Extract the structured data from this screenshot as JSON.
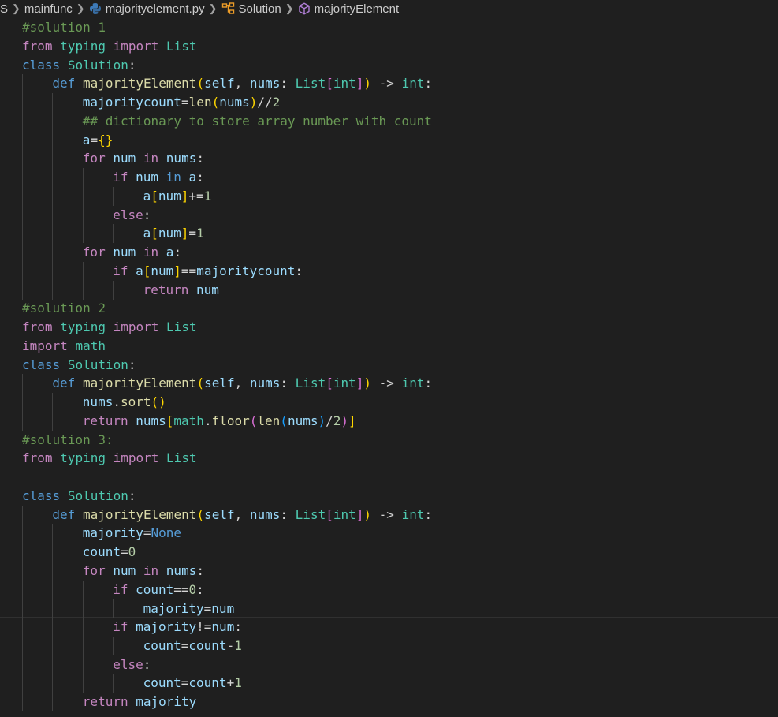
{
  "breadcrumb": {
    "leading": "S",
    "folder": "mainfunc",
    "file": "majorityelement.py",
    "class": "Solution",
    "method": "majorityElement"
  },
  "editor": {
    "current_line_index": 31,
    "colors": {
      "comment": "#6a9955",
      "keyword": "#c586c0",
      "storage": "#569cd6",
      "type": "#4ec9b0",
      "function": "#dcdcaa",
      "variable": "#9cdcfe",
      "number": "#b5cea8",
      "operator": "#d4d4d4",
      "bracket_level1": "#ffd700",
      "bracket_level2": "#da70d6",
      "bracket_level3": "#179fff"
    },
    "lines": [
      {
        "indent": 0,
        "tokens": [
          [
            "c",
            "#solution 1"
          ]
        ]
      },
      {
        "indent": 0,
        "tokens": [
          [
            "k",
            "from"
          ],
          [
            "o",
            " "
          ],
          [
            "t",
            "typing"
          ],
          [
            "o",
            " "
          ],
          [
            "k",
            "import"
          ],
          [
            "o",
            " "
          ],
          [
            "t",
            "List"
          ]
        ]
      },
      {
        "indent": 0,
        "tokens": [
          [
            "s",
            "class"
          ],
          [
            "o",
            " "
          ],
          [
            "t",
            "Solution"
          ],
          [
            "o",
            ":"
          ]
        ]
      },
      {
        "indent": 1,
        "tokens": [
          [
            "s",
            "def"
          ],
          [
            "o",
            " "
          ],
          [
            "f",
            "majorityElement"
          ],
          [
            "b1",
            "("
          ],
          [
            "v",
            "self"
          ],
          [
            "o",
            ", "
          ],
          [
            "v",
            "nums"
          ],
          [
            "o",
            ": "
          ],
          [
            "t",
            "List"
          ],
          [
            "b2",
            "["
          ],
          [
            "t",
            "int"
          ],
          [
            "b2",
            "]"
          ],
          [
            "b1",
            ")"
          ],
          [
            "o",
            " -> "
          ],
          [
            "t",
            "int"
          ],
          [
            "o",
            ":"
          ]
        ]
      },
      {
        "indent": 2,
        "tokens": [
          [
            "v",
            "majoritycount"
          ],
          [
            "o",
            "="
          ],
          [
            "f",
            "len"
          ],
          [
            "b1",
            "("
          ],
          [
            "v",
            "nums"
          ],
          [
            "b1",
            ")"
          ],
          [
            "o",
            "//"
          ],
          [
            "n",
            "2"
          ]
        ]
      },
      {
        "indent": 2,
        "tokens": [
          [
            "c",
            "## dictionary to store array number with count"
          ]
        ]
      },
      {
        "indent": 2,
        "tokens": [
          [
            "v",
            "a"
          ],
          [
            "o",
            "="
          ],
          [
            "b1",
            "{}"
          ]
        ]
      },
      {
        "indent": 2,
        "tokens": [
          [
            "k",
            "for"
          ],
          [
            "o",
            " "
          ],
          [
            "v",
            "num"
          ],
          [
            "o",
            " "
          ],
          [
            "k",
            "in"
          ],
          [
            "o",
            " "
          ],
          [
            "v",
            "nums"
          ],
          [
            "o",
            ":"
          ]
        ]
      },
      {
        "indent": 3,
        "tokens": [
          [
            "k",
            "if"
          ],
          [
            "o",
            " "
          ],
          [
            "v",
            "num"
          ],
          [
            "o",
            " "
          ],
          [
            "s",
            "in"
          ],
          [
            "o",
            " "
          ],
          [
            "v",
            "a"
          ],
          [
            "o",
            ":"
          ]
        ]
      },
      {
        "indent": 4,
        "tokens": [
          [
            "v",
            "a"
          ],
          [
            "b1",
            "["
          ],
          [
            "v",
            "num"
          ],
          [
            "b1",
            "]"
          ],
          [
            "o",
            "+="
          ],
          [
            "n",
            "1"
          ]
        ]
      },
      {
        "indent": 3,
        "tokens": [
          [
            "k",
            "else"
          ],
          [
            "o",
            ":"
          ]
        ]
      },
      {
        "indent": 4,
        "tokens": [
          [
            "v",
            "a"
          ],
          [
            "b1",
            "["
          ],
          [
            "v",
            "num"
          ],
          [
            "b1",
            "]"
          ],
          [
            "o",
            "="
          ],
          [
            "n",
            "1"
          ]
        ]
      },
      {
        "indent": 2,
        "tokens": [
          [
            "k",
            "for"
          ],
          [
            "o",
            " "
          ],
          [
            "v",
            "num"
          ],
          [
            "o",
            " "
          ],
          [
            "k",
            "in"
          ],
          [
            "o",
            " "
          ],
          [
            "v",
            "a"
          ],
          [
            "o",
            ":"
          ]
        ]
      },
      {
        "indent": 3,
        "tokens": [
          [
            "k",
            "if"
          ],
          [
            "o",
            " "
          ],
          [
            "v",
            "a"
          ],
          [
            "b1",
            "["
          ],
          [
            "v",
            "num"
          ],
          [
            "b1",
            "]"
          ],
          [
            "o",
            "=="
          ],
          [
            "v",
            "majoritycount"
          ],
          [
            "o",
            ":"
          ]
        ]
      },
      {
        "indent": 4,
        "tokens": [
          [
            "k",
            "return"
          ],
          [
            "o",
            " "
          ],
          [
            "v",
            "num"
          ]
        ]
      },
      {
        "indent": 0,
        "tokens": [
          [
            "c",
            "#solution 2"
          ]
        ]
      },
      {
        "indent": 0,
        "tokens": [
          [
            "k",
            "from"
          ],
          [
            "o",
            " "
          ],
          [
            "t",
            "typing"
          ],
          [
            "o",
            " "
          ],
          [
            "k",
            "import"
          ],
          [
            "o",
            " "
          ],
          [
            "t",
            "List"
          ]
        ]
      },
      {
        "indent": 0,
        "tokens": [
          [
            "k",
            "import"
          ],
          [
            "o",
            " "
          ],
          [
            "t",
            "math"
          ]
        ]
      },
      {
        "indent": 0,
        "tokens": [
          [
            "s",
            "class"
          ],
          [
            "o",
            " "
          ],
          [
            "t",
            "Solution"
          ],
          [
            "o",
            ":"
          ]
        ]
      },
      {
        "indent": 1,
        "tokens": [
          [
            "s",
            "def"
          ],
          [
            "o",
            " "
          ],
          [
            "f",
            "majorityElement"
          ],
          [
            "b1",
            "("
          ],
          [
            "v",
            "self"
          ],
          [
            "o",
            ", "
          ],
          [
            "v",
            "nums"
          ],
          [
            "o",
            ": "
          ],
          [
            "t",
            "List"
          ],
          [
            "b2",
            "["
          ],
          [
            "t",
            "int"
          ],
          [
            "b2",
            "]"
          ],
          [
            "b1",
            ")"
          ],
          [
            "o",
            " -> "
          ],
          [
            "t",
            "int"
          ],
          [
            "o",
            ":"
          ]
        ]
      },
      {
        "indent": 2,
        "tokens": [
          [
            "v",
            "nums"
          ],
          [
            "o",
            "."
          ],
          [
            "f",
            "sort"
          ],
          [
            "b1",
            "()"
          ]
        ]
      },
      {
        "indent": 2,
        "tokens": [
          [
            "k",
            "return"
          ],
          [
            "o",
            " "
          ],
          [
            "v",
            "nums"
          ],
          [
            "b1",
            "["
          ],
          [
            "t",
            "math"
          ],
          [
            "o",
            "."
          ],
          [
            "f",
            "floor"
          ],
          [
            "b2",
            "("
          ],
          [
            "f",
            "len"
          ],
          [
            "b3",
            "("
          ],
          [
            "v",
            "nums"
          ],
          [
            "b3",
            ")"
          ],
          [
            "o",
            "/"
          ],
          [
            "n",
            "2"
          ],
          [
            "b2",
            ")"
          ],
          [
            "b1",
            "]"
          ]
        ]
      },
      {
        "indent": 0,
        "tokens": [
          [
            "c",
            "#solution 3:"
          ]
        ]
      },
      {
        "indent": 0,
        "tokens": [
          [
            "k",
            "from"
          ],
          [
            "o",
            " "
          ],
          [
            "t",
            "typing"
          ],
          [
            "o",
            " "
          ],
          [
            "k",
            "import"
          ],
          [
            "o",
            " "
          ],
          [
            "t",
            "List"
          ]
        ]
      },
      {
        "indent": 0,
        "tokens": []
      },
      {
        "indent": 0,
        "tokens": [
          [
            "s",
            "class"
          ],
          [
            "o",
            " "
          ],
          [
            "t",
            "Solution"
          ],
          [
            "o",
            ":"
          ]
        ]
      },
      {
        "indent": 1,
        "tokens": [
          [
            "s",
            "def"
          ],
          [
            "o",
            " "
          ],
          [
            "f",
            "majorityElement"
          ],
          [
            "b1",
            "("
          ],
          [
            "v",
            "self"
          ],
          [
            "o",
            ", "
          ],
          [
            "v",
            "nums"
          ],
          [
            "o",
            ": "
          ],
          [
            "t",
            "List"
          ],
          [
            "b2",
            "["
          ],
          [
            "t",
            "int"
          ],
          [
            "b2",
            "]"
          ],
          [
            "b1",
            ")"
          ],
          [
            "o",
            " -> "
          ],
          [
            "t",
            "int"
          ],
          [
            "o",
            ":"
          ]
        ]
      },
      {
        "indent": 2,
        "tokens": [
          [
            "v",
            "majority"
          ],
          [
            "o",
            "="
          ],
          [
            "s",
            "None"
          ]
        ]
      },
      {
        "indent": 2,
        "tokens": [
          [
            "v",
            "count"
          ],
          [
            "o",
            "="
          ],
          [
            "n",
            "0"
          ]
        ]
      },
      {
        "indent": 2,
        "tokens": [
          [
            "k",
            "for"
          ],
          [
            "o",
            " "
          ],
          [
            "v",
            "num"
          ],
          [
            "o",
            " "
          ],
          [
            "k",
            "in"
          ],
          [
            "o",
            " "
          ],
          [
            "v",
            "nums"
          ],
          [
            "o",
            ":"
          ]
        ]
      },
      {
        "indent": 3,
        "tokens": [
          [
            "k",
            "if"
          ],
          [
            "o",
            " "
          ],
          [
            "v",
            "count"
          ],
          [
            "o",
            "=="
          ],
          [
            "n",
            "0"
          ],
          [
            "o",
            ":"
          ]
        ]
      },
      {
        "indent": 4,
        "tokens": [
          [
            "v",
            "majority"
          ],
          [
            "o",
            "="
          ],
          [
            "v",
            "num"
          ]
        ]
      },
      {
        "indent": 3,
        "tokens": [
          [
            "k",
            "if"
          ],
          [
            "o",
            " "
          ],
          [
            "v",
            "majority"
          ],
          [
            "o",
            "!="
          ],
          [
            "v",
            "num"
          ],
          [
            "o",
            ":"
          ]
        ]
      },
      {
        "indent": 4,
        "tokens": [
          [
            "v",
            "count"
          ],
          [
            "o",
            "="
          ],
          [
            "v",
            "count"
          ],
          [
            "o",
            "-"
          ],
          [
            "n",
            "1"
          ]
        ]
      },
      {
        "indent": 3,
        "tokens": [
          [
            "k",
            "else"
          ],
          [
            "o",
            ":"
          ]
        ]
      },
      {
        "indent": 4,
        "tokens": [
          [
            "v",
            "count"
          ],
          [
            "o",
            "="
          ],
          [
            "v",
            "count"
          ],
          [
            "o",
            "+"
          ],
          [
            "n",
            "1"
          ]
        ]
      },
      {
        "indent": 2,
        "tokens": [
          [
            "k",
            "return"
          ],
          [
            "o",
            " "
          ],
          [
            "v",
            "majority"
          ]
        ]
      }
    ]
  }
}
